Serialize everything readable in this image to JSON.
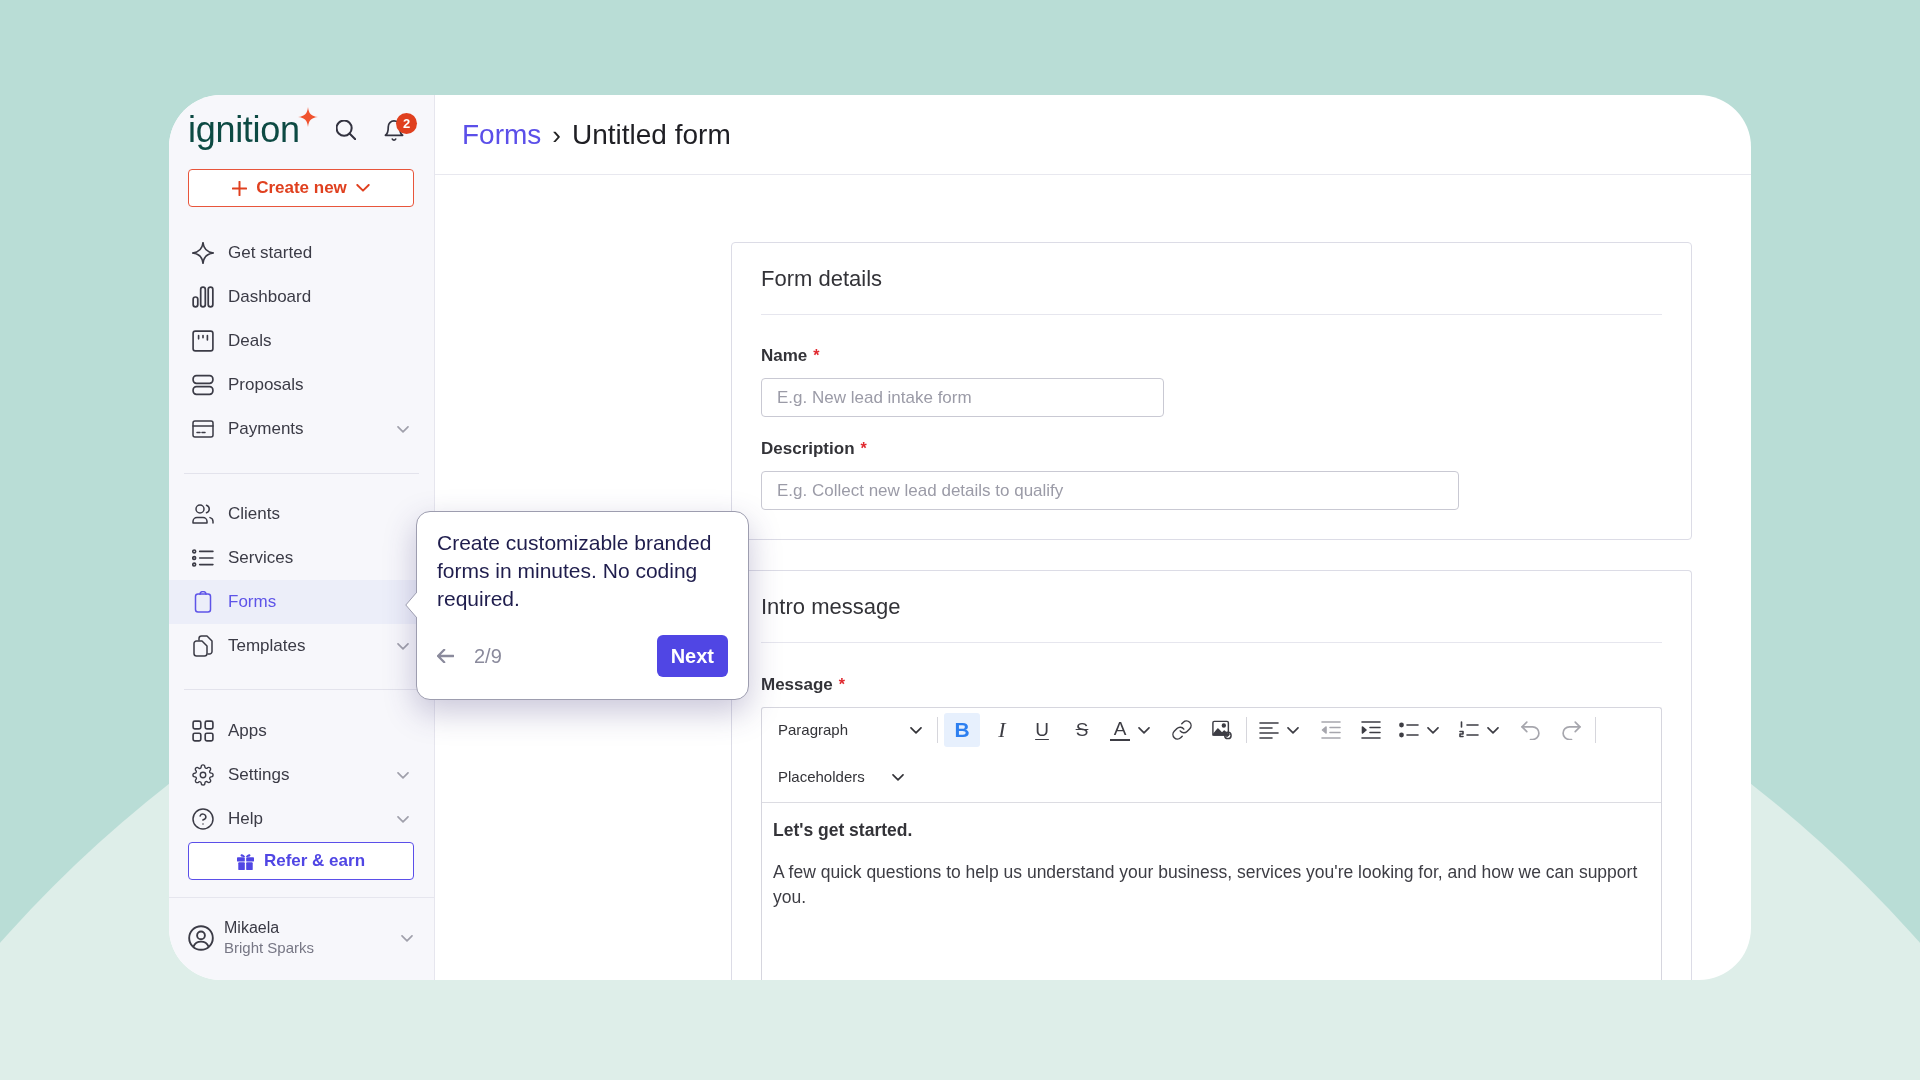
{
  "sidebar": {
    "logo": "ignition",
    "notification_count": "2",
    "create_button": "Create new",
    "nav_groups": [
      [
        {
          "label": "Get started",
          "selected": false,
          "expandable": false
        },
        {
          "label": "Dashboard",
          "selected": false,
          "expandable": false
        },
        {
          "label": "Deals",
          "selected": false,
          "expandable": false
        },
        {
          "label": "Proposals",
          "selected": false,
          "expandable": false
        },
        {
          "label": "Payments",
          "selected": false,
          "expandable": true
        }
      ],
      [
        {
          "label": "Clients",
          "selected": false,
          "expandable": false
        },
        {
          "label": "Services",
          "selected": false,
          "expandable": false
        },
        {
          "label": "Forms",
          "selected": true,
          "expandable": false
        },
        {
          "label": "Templates",
          "selected": false,
          "expandable": true
        }
      ],
      [
        {
          "label": "Apps",
          "selected": false,
          "expandable": false
        },
        {
          "label": "Settings",
          "selected": false,
          "expandable": true
        },
        {
          "label": "Help",
          "selected": false,
          "expandable": true
        }
      ]
    ],
    "refer_button": "Refer & earn",
    "user": {
      "name": "Mikaela",
      "organization": "Bright Sparks"
    }
  },
  "header": {
    "breadcrumb": {
      "parent": "Forms",
      "separator": "›",
      "current": "Untitled form"
    }
  },
  "form_details": {
    "title": "Form details",
    "fields": [
      {
        "label": "Name",
        "required_mark": "*",
        "placeholder": "E.g. New lead intake form"
      },
      {
        "label": "Description",
        "required_mark": "*",
        "placeholder": "E.g. Collect new lead details to qualify"
      }
    ]
  },
  "intro_message": {
    "title": "Intro message",
    "message": {
      "label": "Message",
      "required_mark": "*",
      "toolbar": {
        "block_format": "Paragraph",
        "groups": [
          [
            {
              "kind": "glyph",
              "glyph": "B",
              "active": true,
              "disabled": false,
              "menu": false
            },
            {
              "kind": "glyph",
              "glyph": "I",
              "active": false,
              "disabled": false,
              "menu": false
            },
            {
              "kind": "glyph",
              "glyph": "U",
              "active": false,
              "disabled": false,
              "menu": false
            },
            {
              "kind": "glyph",
              "glyph": "S",
              "active": false,
              "disabled": false,
              "menu": false
            },
            {
              "kind": "glyph",
              "glyph": "A",
              "active": false,
              "disabled": false,
              "menu": true
            },
            {
              "kind": "icon",
              "active": false,
              "disabled": false,
              "menu": false
            },
            {
              "kind": "icon",
              "active": false,
              "disabled": false,
              "menu": false
            }
          ],
          [
            {
              "kind": "icon",
              "active": false,
              "disabled": false,
              "menu": true
            },
            {
              "kind": "icon",
              "active": false,
              "disabled": true,
              "menu": false
            },
            {
              "kind": "icon",
              "active": false,
              "disabled": false,
              "menu": false
            },
            {
              "kind": "icon",
              "active": false,
              "disabled": false,
              "menu": true
            },
            {
              "kind": "icon",
              "active": false,
              "disabled": false,
              "menu": true
            },
            {
              "kind": "icon",
              "active": false,
              "disabled": true,
              "menu": false
            },
            {
              "kind": "icon",
              "active": false,
              "disabled": true,
              "menu": false
            }
          ]
        ],
        "insert_menu": "Placeholders"
      },
      "content": [
        {
          "kind": "heading",
          "text": "Let's get started."
        },
        {
          "kind": "paragraph",
          "text": "A few quick questions to help us understand your business, services you're looking for, and how we can support you."
        }
      ]
    }
  },
  "tour_tooltip": {
    "text": "Create customizable branded forms in minutes. No coding required.",
    "step": "2/9",
    "next_button": "Next"
  }
}
